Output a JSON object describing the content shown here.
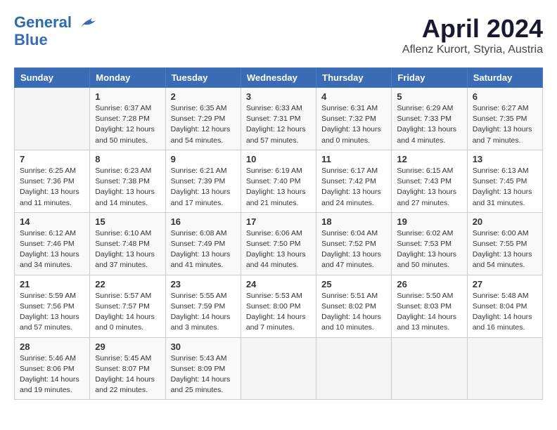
{
  "header": {
    "logo_line1": "General",
    "logo_line2": "Blue",
    "month_title": "April 2024",
    "subtitle": "Aflenz Kurort, Styria, Austria"
  },
  "days_of_week": [
    "Sunday",
    "Monday",
    "Tuesday",
    "Wednesday",
    "Thursday",
    "Friday",
    "Saturday"
  ],
  "weeks": [
    [
      {
        "day": "",
        "content": ""
      },
      {
        "day": "1",
        "content": "Sunrise: 6:37 AM\nSunset: 7:28 PM\nDaylight: 12 hours\nand 50 minutes."
      },
      {
        "day": "2",
        "content": "Sunrise: 6:35 AM\nSunset: 7:29 PM\nDaylight: 12 hours\nand 54 minutes."
      },
      {
        "day": "3",
        "content": "Sunrise: 6:33 AM\nSunset: 7:31 PM\nDaylight: 12 hours\nand 57 minutes."
      },
      {
        "day": "4",
        "content": "Sunrise: 6:31 AM\nSunset: 7:32 PM\nDaylight: 13 hours\nand 0 minutes."
      },
      {
        "day": "5",
        "content": "Sunrise: 6:29 AM\nSunset: 7:33 PM\nDaylight: 13 hours\nand 4 minutes."
      },
      {
        "day": "6",
        "content": "Sunrise: 6:27 AM\nSunset: 7:35 PM\nDaylight: 13 hours\nand 7 minutes."
      }
    ],
    [
      {
        "day": "7",
        "content": "Sunrise: 6:25 AM\nSunset: 7:36 PM\nDaylight: 13 hours\nand 11 minutes."
      },
      {
        "day": "8",
        "content": "Sunrise: 6:23 AM\nSunset: 7:38 PM\nDaylight: 13 hours\nand 14 minutes."
      },
      {
        "day": "9",
        "content": "Sunrise: 6:21 AM\nSunset: 7:39 PM\nDaylight: 13 hours\nand 17 minutes."
      },
      {
        "day": "10",
        "content": "Sunrise: 6:19 AM\nSunset: 7:40 PM\nDaylight: 13 hours\nand 21 minutes."
      },
      {
        "day": "11",
        "content": "Sunrise: 6:17 AM\nSunset: 7:42 PM\nDaylight: 13 hours\nand 24 minutes."
      },
      {
        "day": "12",
        "content": "Sunrise: 6:15 AM\nSunset: 7:43 PM\nDaylight: 13 hours\nand 27 minutes."
      },
      {
        "day": "13",
        "content": "Sunrise: 6:13 AM\nSunset: 7:45 PM\nDaylight: 13 hours\nand 31 minutes."
      }
    ],
    [
      {
        "day": "14",
        "content": "Sunrise: 6:12 AM\nSunset: 7:46 PM\nDaylight: 13 hours\nand 34 minutes."
      },
      {
        "day": "15",
        "content": "Sunrise: 6:10 AM\nSunset: 7:48 PM\nDaylight: 13 hours\nand 37 minutes."
      },
      {
        "day": "16",
        "content": "Sunrise: 6:08 AM\nSunset: 7:49 PM\nDaylight: 13 hours\nand 41 minutes."
      },
      {
        "day": "17",
        "content": "Sunrise: 6:06 AM\nSunset: 7:50 PM\nDaylight: 13 hours\nand 44 minutes."
      },
      {
        "day": "18",
        "content": "Sunrise: 6:04 AM\nSunset: 7:52 PM\nDaylight: 13 hours\nand 47 minutes."
      },
      {
        "day": "19",
        "content": "Sunrise: 6:02 AM\nSunset: 7:53 PM\nDaylight: 13 hours\nand 50 minutes."
      },
      {
        "day": "20",
        "content": "Sunrise: 6:00 AM\nSunset: 7:55 PM\nDaylight: 13 hours\nand 54 minutes."
      }
    ],
    [
      {
        "day": "21",
        "content": "Sunrise: 5:59 AM\nSunset: 7:56 PM\nDaylight: 13 hours\nand 57 minutes."
      },
      {
        "day": "22",
        "content": "Sunrise: 5:57 AM\nSunset: 7:57 PM\nDaylight: 14 hours\nand 0 minutes."
      },
      {
        "day": "23",
        "content": "Sunrise: 5:55 AM\nSunset: 7:59 PM\nDaylight: 14 hours\nand 3 minutes."
      },
      {
        "day": "24",
        "content": "Sunrise: 5:53 AM\nSunset: 8:00 PM\nDaylight: 14 hours\nand 7 minutes."
      },
      {
        "day": "25",
        "content": "Sunrise: 5:51 AM\nSunset: 8:02 PM\nDaylight: 14 hours\nand 10 minutes."
      },
      {
        "day": "26",
        "content": "Sunrise: 5:50 AM\nSunset: 8:03 PM\nDaylight: 14 hours\nand 13 minutes."
      },
      {
        "day": "27",
        "content": "Sunrise: 5:48 AM\nSunset: 8:04 PM\nDaylight: 14 hours\nand 16 minutes."
      }
    ],
    [
      {
        "day": "28",
        "content": "Sunrise: 5:46 AM\nSunset: 8:06 PM\nDaylight: 14 hours\nand 19 minutes."
      },
      {
        "day": "29",
        "content": "Sunrise: 5:45 AM\nSunset: 8:07 PM\nDaylight: 14 hours\nand 22 minutes."
      },
      {
        "day": "30",
        "content": "Sunrise: 5:43 AM\nSunset: 8:09 PM\nDaylight: 14 hours\nand 25 minutes."
      },
      {
        "day": "",
        "content": ""
      },
      {
        "day": "",
        "content": ""
      },
      {
        "day": "",
        "content": ""
      },
      {
        "day": "",
        "content": ""
      }
    ]
  ]
}
